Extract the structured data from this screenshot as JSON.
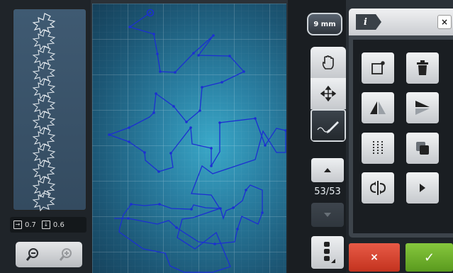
{
  "left_panel": {
    "stitch_width": "0.7",
    "stitch_length": "0.6",
    "width_icon": "arrow-right-icon",
    "length_icon": "arrow-down-icon",
    "zoom_out_icon": "zoom-out-icon",
    "zoom_in_icon": "zoom-in-icon"
  },
  "tools": {
    "width_label": "9 mm",
    "counter": "53/53",
    "mode_icons": [
      "hand-icon",
      "move-icon",
      "draw-stitch-icon"
    ]
  },
  "edit_panel": {
    "info_label": "i",
    "close_label": "×",
    "tool_icons": [
      "new-page-icon",
      "trash-icon",
      "mirror-horizontal-icon",
      "mirror-vertical-icon",
      "stitch-columns-icon",
      "duplicate-icon",
      "mirror-flip-icon",
      "play-icon"
    ]
  },
  "actions": {
    "cancel_label": "×",
    "ok_label": "✓"
  },
  "colors": {
    "canvas": "#2a7fa2",
    "stitch_line": "#1c2fd2",
    "cancel": "#d23c28",
    "ok": "#6fb22c"
  }
}
